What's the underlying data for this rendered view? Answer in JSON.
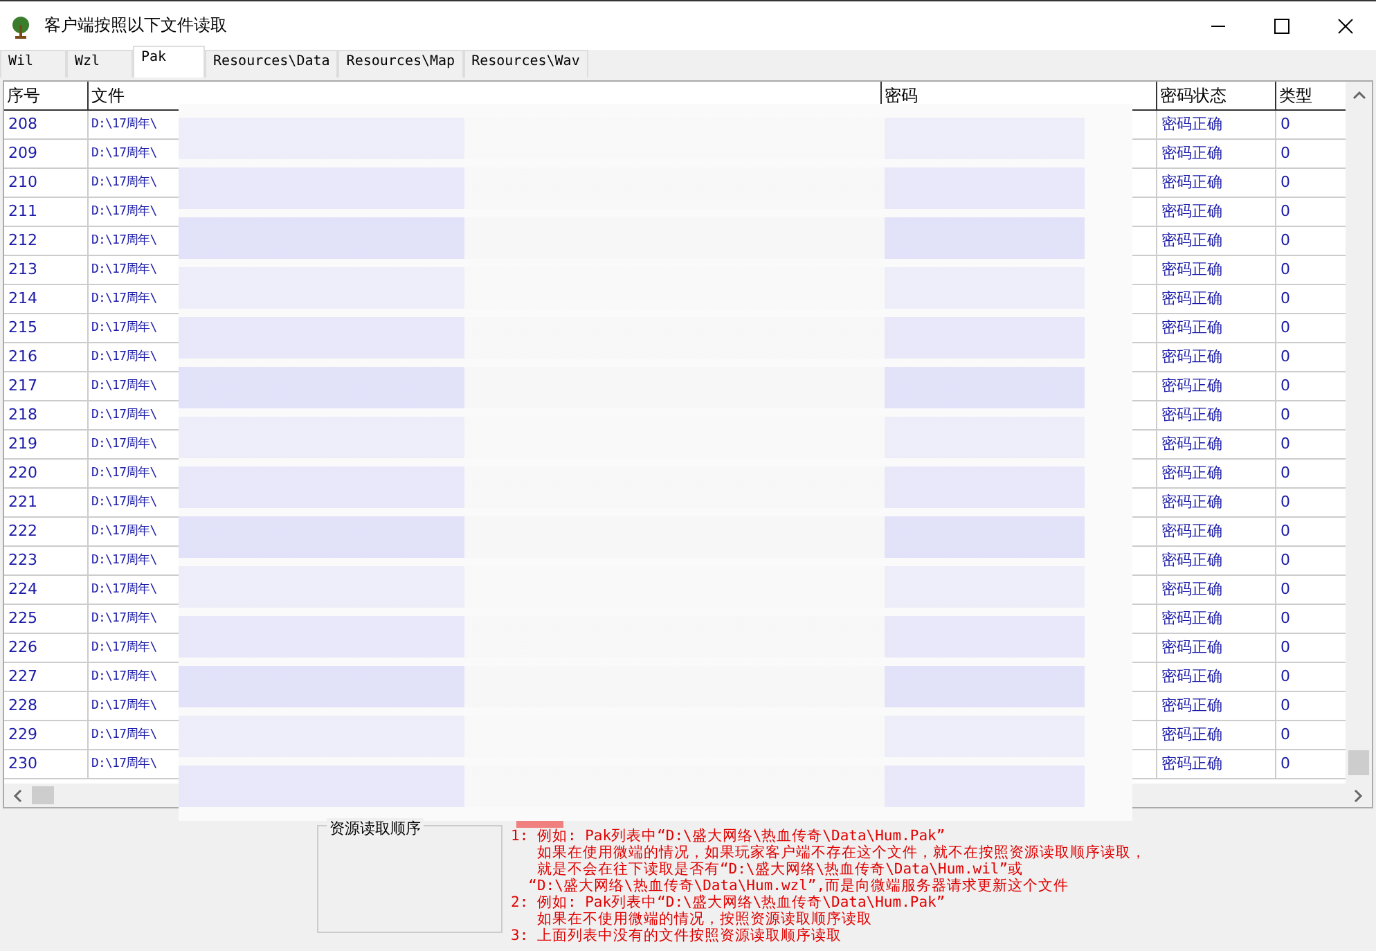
{
  "window": {
    "title": "客户端按照以下文件读取"
  },
  "tabs": [
    {
      "label": "Wil",
      "selected": false
    },
    {
      "label": "Wzl",
      "selected": false
    },
    {
      "label": "Pak",
      "selected": true
    },
    {
      "label": "Resources\\Data",
      "selected": false
    },
    {
      "label": "Resources\\Map",
      "selected": false
    },
    {
      "label": "Resources\\Wav",
      "selected": false
    }
  ],
  "table": {
    "columns": [
      "序号",
      "文件",
      "密码",
      "密码状态",
      "类型"
    ],
    "rows": [
      {
        "no": "208",
        "file": "D:\\17周年\\",
        "status": "密码正确",
        "type": "0"
      },
      {
        "no": "209",
        "file": "D:\\17周年\\",
        "status": "密码正确",
        "type": "0"
      },
      {
        "no": "210",
        "file": "D:\\17周年\\",
        "status": "密码正确",
        "type": "0"
      },
      {
        "no": "211",
        "file": "D:\\17周年\\",
        "status": "密码正确",
        "type": "0"
      },
      {
        "no": "212",
        "file": "D:\\17周年\\",
        "status": "密码正确",
        "type": "0"
      },
      {
        "no": "213",
        "file": "D:\\17周年\\",
        "status": "密码正确",
        "type": "0"
      },
      {
        "no": "214",
        "file": "D:\\17周年\\",
        "status": "密码正确",
        "type": "0"
      },
      {
        "no": "215",
        "file": "D:\\17周年\\",
        "status": "密码正确",
        "type": "0"
      },
      {
        "no": "216",
        "file": "D:\\17周年\\",
        "status": "密码正确",
        "type": "0"
      },
      {
        "no": "217",
        "file": "D:\\17周年\\",
        "status": "密码正确",
        "type": "0"
      },
      {
        "no": "218",
        "file": "D:\\17周年\\",
        "status": "密码正确",
        "type": "0"
      },
      {
        "no": "219",
        "file": "D:\\17周年\\",
        "status": "密码正确",
        "type": "0"
      },
      {
        "no": "220",
        "file": "D:\\17周年\\",
        "status": "密码正确",
        "type": "0"
      },
      {
        "no": "221",
        "file": "D:\\17周年\\",
        "status": "密码正确",
        "type": "0"
      },
      {
        "no": "222",
        "file": "D:\\17周年\\",
        "status": "密码正确",
        "type": "0"
      },
      {
        "no": "223",
        "file": "D:\\17周年\\",
        "status": "密码正确",
        "type": "0"
      },
      {
        "no": "224",
        "file": "D:\\17周年\\",
        "status": "密码正确",
        "type": "0"
      },
      {
        "no": "225",
        "file": "D:\\17周年\\",
        "status": "密码正确",
        "type": "0"
      },
      {
        "no": "226",
        "file": "D:\\17周年\\",
        "status": "密码正确",
        "type": "0"
      },
      {
        "no": "227",
        "file": "D:\\17周年\\",
        "status": "密码正确",
        "type": "0"
      },
      {
        "no": "228",
        "file": "D:\\17周年\\",
        "status": "密码正确",
        "type": "0"
      },
      {
        "no": "229",
        "file": "D:\\17周年\\",
        "status": "密码正确",
        "type": "0"
      },
      {
        "no": "230",
        "file": "D:\\17周年\\",
        "status": "密码正确",
        "type": "0"
      }
    ]
  },
  "group_box": {
    "title": "资源读取顺序"
  },
  "notes": [
    "1: 例如: Pak列表中“D:\\盛大网络\\热血传奇\\Data\\Hum.Pak”",
    "   如果在使用微端的情况，如果玩家客户端不存在这个文件，就不在按照资源读取顺序读取，",
    "   就是不会在往下读取是否有“D:\\盛大网络\\热血传奇\\Data\\Hum.wil”或",
    "  “D:\\盛大网络\\热血传奇\\Data\\Hum.wzl”,而是向微端服务器请求更新这个文件",
    "2: 例如: Pak列表中“D:\\盛大网络\\热血传奇\\Data\\Hum.Pak”",
    "   如果在不使用微端的情况，按照资源读取顺序读取",
    "3: 上面列表中没有的文件按照资源读取顺序读取"
  ]
}
